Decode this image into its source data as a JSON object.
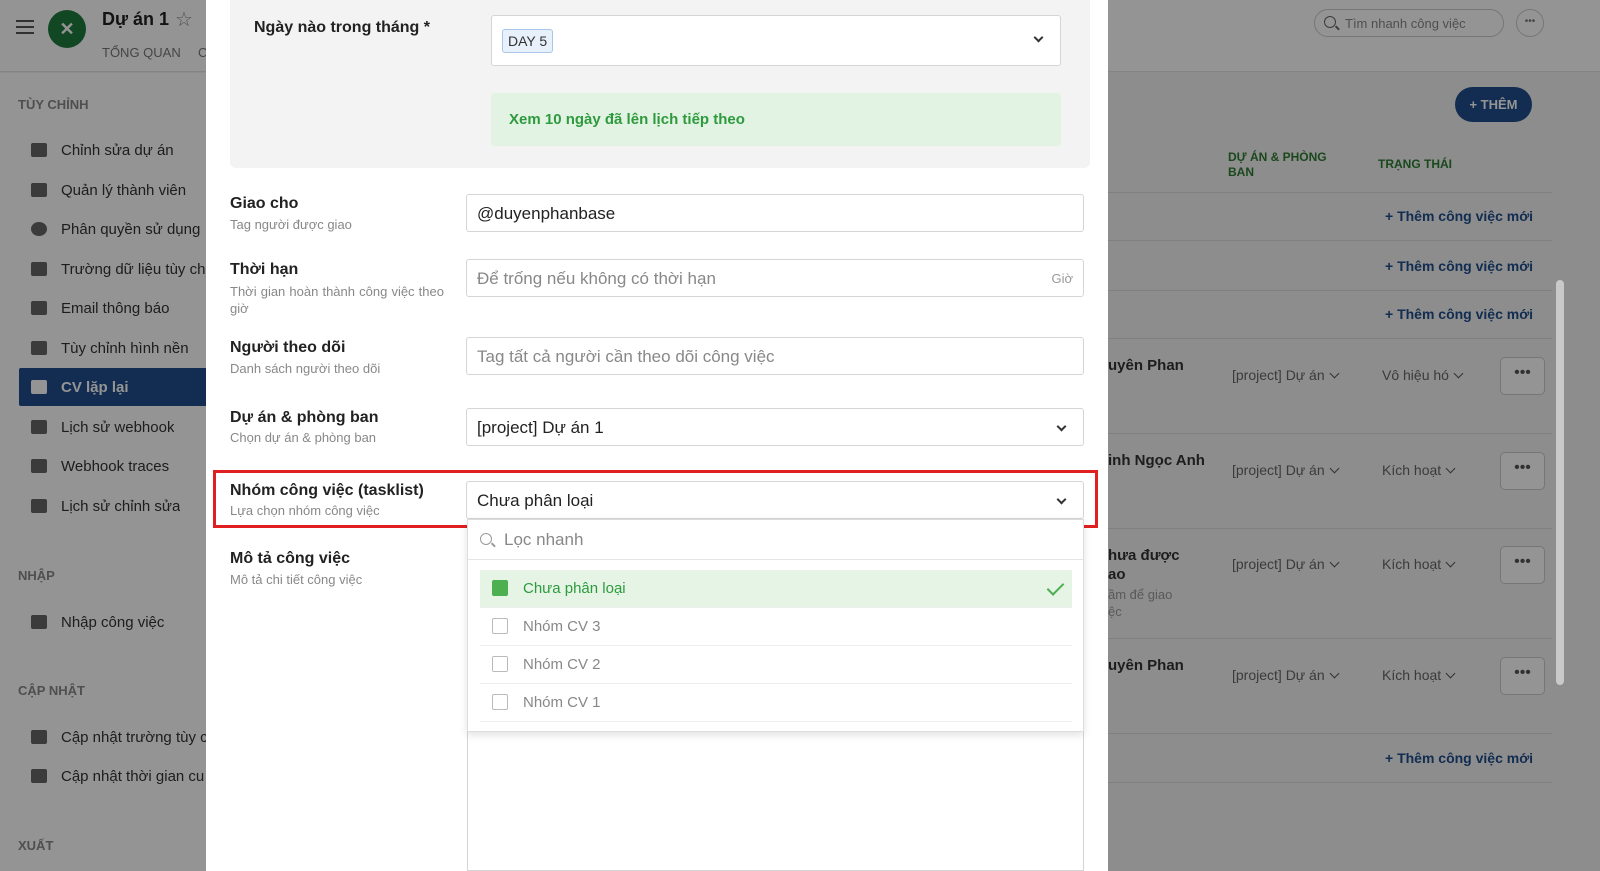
{
  "header": {
    "project_title": "Dự án 1",
    "subnav": "TỔNG QUAN",
    "subnav_cut": "C",
    "search_placeholder": "Tìm nhanh công việc",
    "more": "•••"
  },
  "sidebar": {
    "sections": {
      "customize": "TÙY CHỈNH",
      "import": "NHẬP",
      "update": "CẬP NHẬT",
      "export": "XUẤT"
    },
    "items": [
      {
        "label": "Chỉnh sửa dự án"
      },
      {
        "label": "Quản lý thành viên"
      },
      {
        "label": "Phân quyền sử dụng"
      },
      {
        "label": "Trường dữ liệu tùy ch"
      },
      {
        "label": "Email thông báo"
      },
      {
        "label": "Tùy chỉnh hình nền"
      },
      {
        "label": "CV lặp lại"
      },
      {
        "label": "Lịch sử webhook"
      },
      {
        "label": "Webhook traces"
      },
      {
        "label": "Lịch sử chỉnh sửa"
      },
      {
        "label": "Nhập công việc"
      },
      {
        "label": "Cập nhật trường tùy c"
      },
      {
        "label": "Cập nhật thời gian cu"
      }
    ]
  },
  "table": {
    "add_button": "+ THÊM",
    "col_project": "DỰ ÁN & PHÒNG BAN",
    "col_status": "TRẠNG THÁI",
    "add_task": "+ Thêm công việc mới",
    "rows": [
      {
        "assignee": "uyên Phan",
        "sub": "",
        "project": "[project] Dự án",
        "status": "Vô hiệu hó"
      },
      {
        "assignee": "inh Ngọc Anh",
        "sub": "",
        "project": "[project] Dự án",
        "status": "Kích hoạt"
      },
      {
        "assignee": "hưa được",
        "assignee2": "ao",
        "sub": "ầm để giao",
        "sub2": "ệc",
        "project": "[project] Dự án",
        "status": "Kích hoạt"
      },
      {
        "assignee": "uyên Phan",
        "sub": "",
        "project": "[project] Dự án",
        "status": "Kích hoạt"
      }
    ],
    "dots": "•••"
  },
  "modal": {
    "day_of_month": {
      "label": "Ngày nào trong tháng *",
      "value": "DAY 5"
    },
    "preview_button": "Xem 10 ngày đã lên lịch tiếp theo",
    "assign": {
      "label": "Giao cho",
      "sub": "Tag người được giao",
      "value": "@duyenphanbase"
    },
    "deadline": {
      "label": "Thời hạn",
      "sub": "Thời gian hoàn thành công việc theo giờ",
      "placeholder": "Để trống nếu không có thời hạn",
      "suffix": "Giờ"
    },
    "followers": {
      "label": "Người theo dõi",
      "sub": "Danh sách người theo dõi",
      "placeholder": "Tag tất cả người cần theo dõi công việc"
    },
    "project": {
      "label": "Dự án & phòng ban",
      "sub": "Chọn dự án & phòng ban",
      "value": "[project] Dự án 1"
    },
    "tasklist": {
      "label": "Nhóm công việc (tasklist)",
      "sub": "Lựa chọn nhóm công việc",
      "value": "Chưa phân loại"
    },
    "description": {
      "label": "Mô tả công việc",
      "sub": "Mô tả chi tiết công việc"
    },
    "dropdown": {
      "search_placeholder": "Lọc nhanh",
      "options": [
        {
          "label": "Chưa phân loại",
          "selected": true
        },
        {
          "label": "Nhóm CV 3",
          "selected": false
        },
        {
          "label": "Nhóm CV 2",
          "selected": false
        },
        {
          "label": "Nhóm CV 1",
          "selected": false
        }
      ]
    }
  },
  "colors": {
    "accent": "#1f4e8c",
    "green": "#2e9a3e",
    "highlight": "#e02020"
  }
}
